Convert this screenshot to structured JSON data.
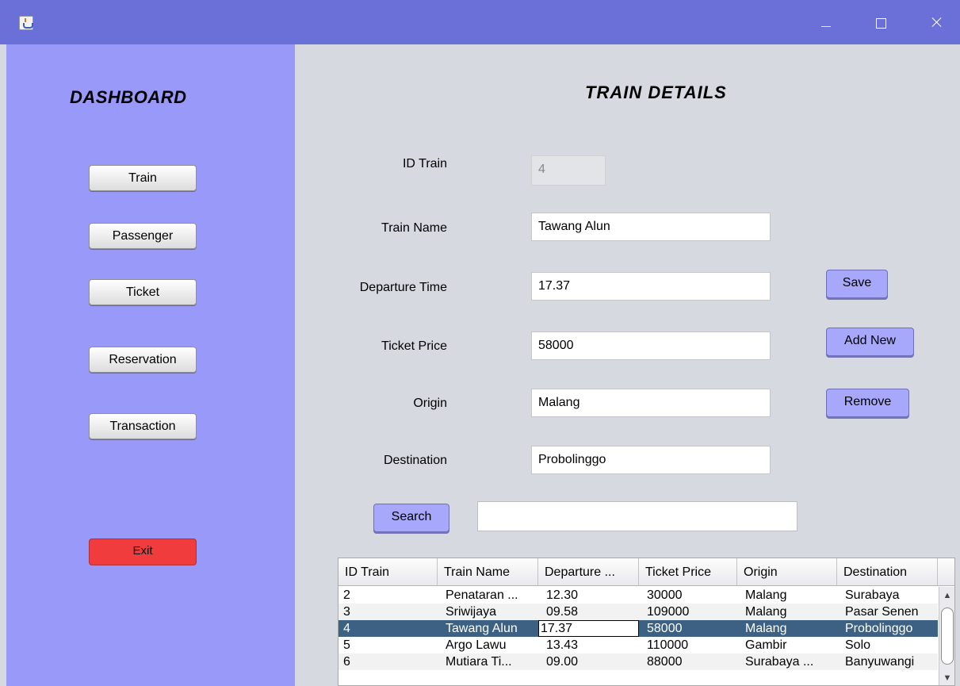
{
  "window": {
    "icon": "java-cup-icon",
    "minimize": "minimize-icon",
    "maximize": "maximize-icon",
    "close": "close-icon"
  },
  "sidebar": {
    "title": "DASHBOARD",
    "items": [
      {
        "label": "Train"
      },
      {
        "label": "Passenger"
      },
      {
        "label": "Ticket"
      },
      {
        "label": "Reservation"
      },
      {
        "label": "Transaction"
      }
    ],
    "exit_label": "Exit",
    "exit_color": "#f03c3c",
    "background": "#9999fa"
  },
  "main": {
    "title": "TRAIN DETAILS",
    "fields": {
      "id_train": {
        "label": "ID Train",
        "value": "4"
      },
      "train_name": {
        "label": "Train Name",
        "value": "Tawang Alun"
      },
      "departure_time": {
        "label": "Departure Time",
        "value": "17.37"
      },
      "ticket_price": {
        "label": "Ticket Price",
        "value": "58000"
      },
      "origin": {
        "label": "Origin",
        "value": "Malang"
      },
      "destination": {
        "label": "Destination",
        "value": "Probolinggo"
      }
    },
    "buttons": {
      "save": "Save",
      "add_new": "Add New",
      "remove": "Remove",
      "search": "Search"
    },
    "search": {
      "value": ""
    },
    "accent": "#a7a7fb"
  },
  "table": {
    "columns": [
      "ID Train",
      "Train Name",
      "Departure ...",
      "Ticket Price",
      "Origin",
      "Destination"
    ],
    "rows": [
      [
        "2",
        "Penataran ...",
        "12.30",
        "30000",
        "Malang",
        "Surabaya"
      ],
      [
        "3",
        "Sriwijaya",
        "09.58",
        "109000",
        "Malang",
        "Pasar Senen"
      ],
      [
        "4",
        "Tawang Alun",
        "17.37",
        "58000",
        "Malang",
        "Probolinggo"
      ],
      [
        "5",
        "Argo Lawu",
        "13.43",
        "110000",
        "Gambir",
        "Solo"
      ],
      [
        "6",
        "Mutiara Ti...",
        "09.00",
        "88000",
        "Surabaya ...",
        "Banyuwangi"
      ]
    ],
    "selected_row": 2,
    "selection_color": "#3c6183"
  }
}
